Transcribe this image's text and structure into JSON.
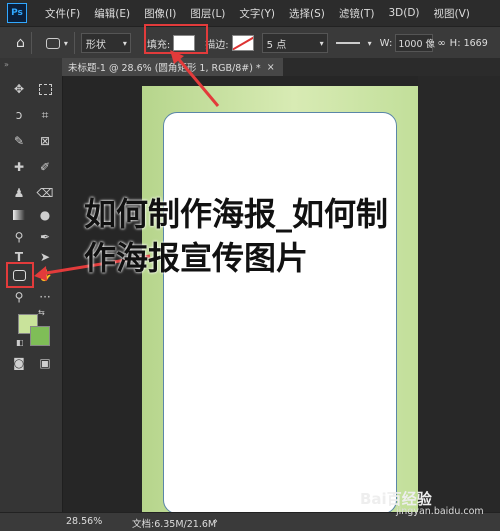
{
  "menubar": {
    "logo_text": "Ps",
    "items": [
      "文件(F)",
      "编辑(E)",
      "图像(I)",
      "图层(L)",
      "文字(Y)",
      "选择(S)",
      "滤镜(T)",
      "3D(D)",
      "视图(V)"
    ]
  },
  "options_bar": {
    "mode_label": "形状",
    "fill_label": "填充:",
    "fill_color": "#ffffff",
    "stroke_label": "描边:",
    "stroke_width": "5 点",
    "w_label": "W:",
    "w_value": "1000 像",
    "h_label": "H:",
    "h_value": "1669"
  },
  "tab": {
    "title": "未标题-1 @ 28.6% (圆角矩形 1, RGB/8#) *",
    "close": "×"
  },
  "colors": {
    "foreground": "#c9e39b",
    "background": "#7fbe57",
    "doc_green_light": "#d8ebb4",
    "doc_green": "#b6d58c",
    "card_border": "#5a86a8",
    "highlight_red": "#e23b3b"
  },
  "tools": [
    "move-icon",
    "marquee-icon",
    "lasso-icon",
    "crop-icon",
    "eyedropper-icon",
    "frame-icon",
    "healing-brush-icon",
    "brush-icon",
    "clone-stamp-icon",
    "eraser-icon",
    "gradient-icon",
    "blur-icon",
    "dodge-icon",
    "pen-icon",
    "type-icon",
    "path-select-icon",
    "rounded-rectangle-icon",
    "hand-icon",
    "zoom-icon",
    "more-icon",
    "quick-mask-icon",
    "screen-mode-icon"
  ],
  "status": {
    "zoom": "28.56%",
    "doc_info": "文档:6.35M/21.6M"
  },
  "overlay": {
    "title_line1": "如何制作海报_如何制",
    "title_line2": "作海报宣传图片",
    "brand": "Bai百经验",
    "brand_url": "jingyan.baidu.com"
  }
}
